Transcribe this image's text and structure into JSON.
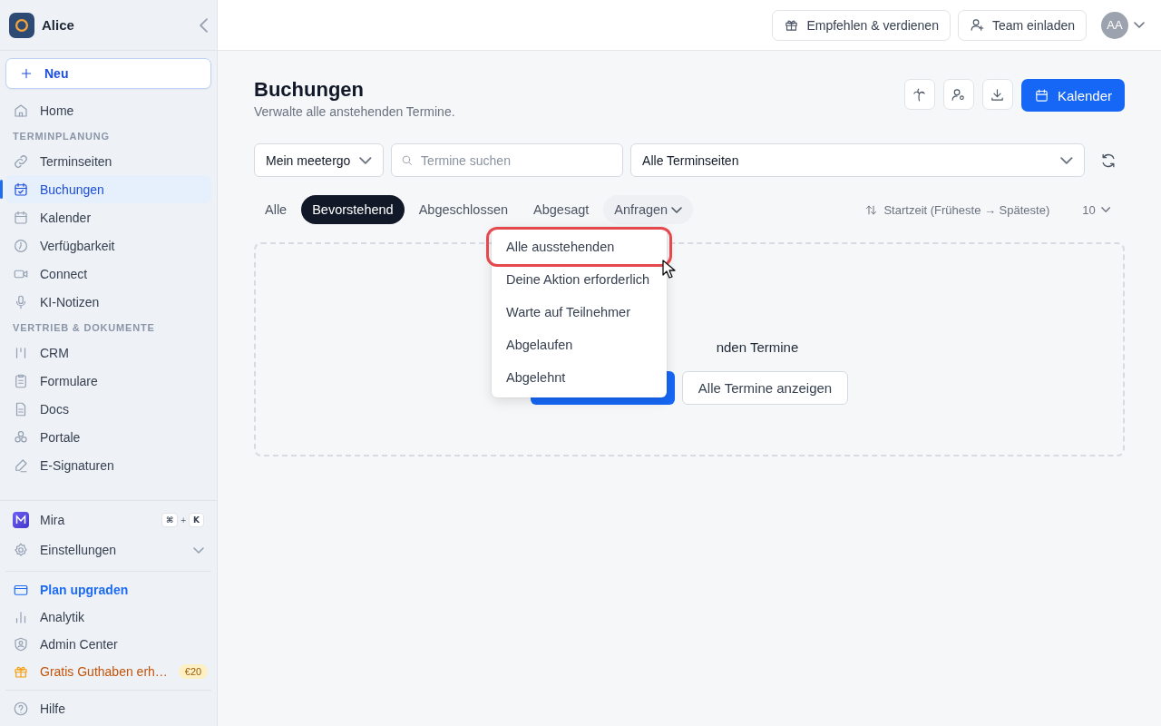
{
  "sidebar": {
    "workspace": "Alice",
    "new_button": "Neu",
    "sections": [
      {
        "items": [
          {
            "label": "Home",
            "selected": false
          }
        ]
      },
      {
        "title": "TERMINPLANUNG",
        "items": [
          {
            "label": "Terminseiten",
            "selected": false
          },
          {
            "label": "Buchungen",
            "selected": true
          },
          {
            "label": "Kalender",
            "selected": false
          },
          {
            "label": "Verfügbarkeit",
            "selected": false
          },
          {
            "label": "Connect",
            "selected": false
          },
          {
            "label": "KI-Notizen",
            "selected": false
          }
        ]
      },
      {
        "title": "VERTRIEB & DOKUMENTE",
        "items": [
          {
            "label": "CRM",
            "selected": false
          },
          {
            "label": "Formulare",
            "selected": false
          },
          {
            "label": "Docs",
            "selected": false
          },
          {
            "label": "Portale",
            "selected": false
          },
          {
            "label": "E-Signaturen",
            "selected": false
          }
        ]
      }
    ],
    "assistant": {
      "label": "Mira",
      "keys": [
        "⌘",
        "+",
        "K"
      ]
    },
    "settings": {
      "label": "Einstellungen",
      "expanded": false
    },
    "links": [
      {
        "label": "Plan upgraden",
        "kind": "upgrade"
      },
      {
        "label": "Analytik",
        "kind": "plain"
      },
      {
        "label": "Admin Center",
        "kind": "plain"
      },
      {
        "label": "Gratis Guthaben erh…",
        "kind": "promo",
        "badge": "€20"
      }
    ],
    "help": "Hilfe"
  },
  "header": {
    "buttons": [
      "Empfehlen & verdienen",
      "Team einladen"
    ],
    "avatar": "AA"
  },
  "page": {
    "title": "Buchungen",
    "subtitle": "Verwalte alle anstehenden Termine.",
    "primary_button": "Kalender",
    "filters": {
      "owner": "Mein meetergo",
      "search": {
        "placeholder": "Termine suchen"
      },
      "pages": "Alle Terminseiten"
    },
    "tabs": [
      {
        "label": "Alle",
        "selected": false,
        "kind": "plain"
      },
      {
        "label": "Bevorstehend",
        "selected": true,
        "kind": "plain"
      },
      {
        "label": "Abgeschlossen",
        "selected": false,
        "kind": "plain"
      },
      {
        "label": "Abgesagt",
        "selected": false,
        "kind": "plain"
      },
      {
        "label": "Anfragen",
        "selected": false,
        "kind": "dropdown",
        "expanded": true
      }
    ],
    "sort": "Startzeit (Früheste → Späteste)",
    "page_size": "10",
    "menu": [
      {
        "label": "Alle ausstehenden",
        "selected": true
      },
      {
        "label": "Deine Aktion erforderlich",
        "selected": false
      },
      {
        "label": "Warte auf Teilnehmer",
        "selected": false
      },
      {
        "label": "Abgelaufen",
        "selected": false
      },
      {
        "label": "Abgelehnt",
        "selected": false
      }
    ],
    "empty_state": {
      "message": "nden Termine",
      "secondary_button": "Alle Termine anzeigen"
    }
  }
}
